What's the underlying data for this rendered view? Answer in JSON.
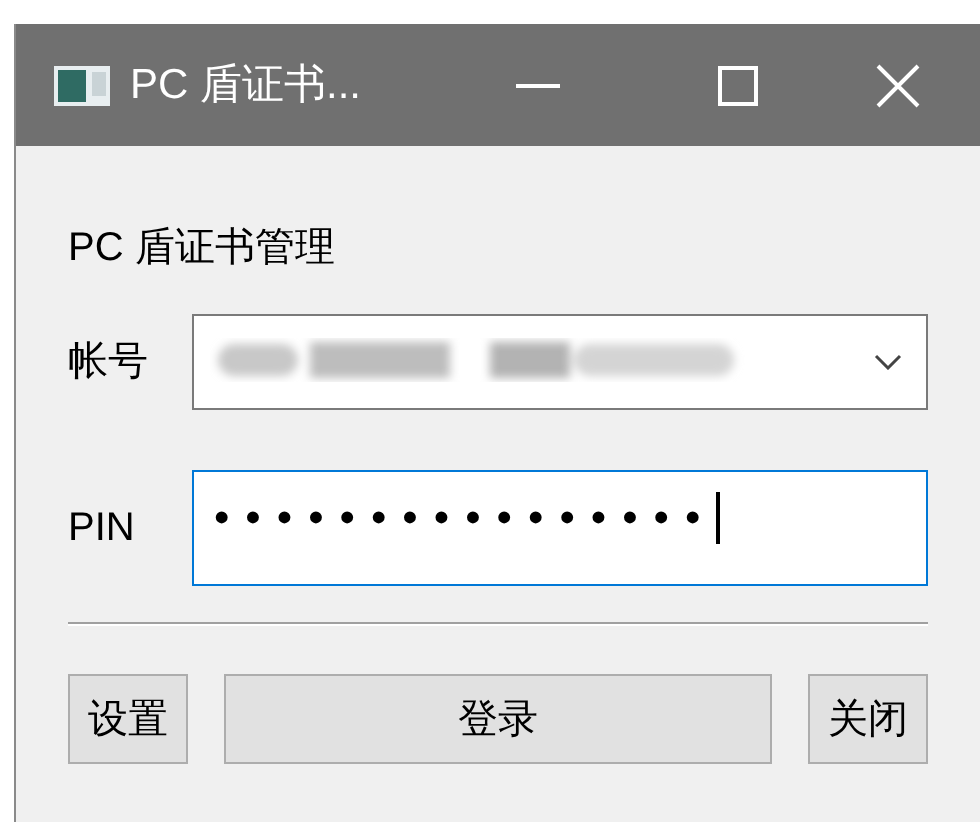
{
  "window": {
    "title": "PC 盾证书..."
  },
  "heading": "PC 盾证书管理",
  "account": {
    "label": "帐号"
  },
  "pin": {
    "label": "PIN",
    "value": "••••••••••••••••",
    "focused": true
  },
  "buttons": [
    {
      "label": "设置",
      "kind": "small"
    },
    {
      "label": "登录",
      "kind": "wide"
    },
    {
      "label": "关闭",
      "kind": "small"
    }
  ]
}
